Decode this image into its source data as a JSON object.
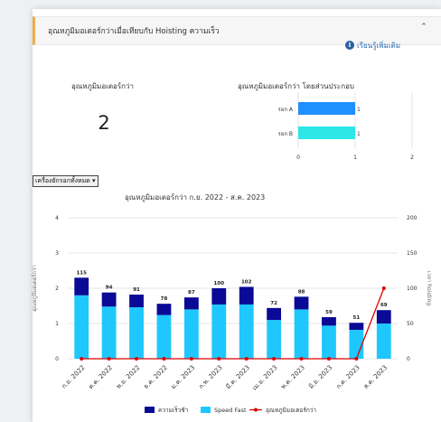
{
  "panel": {
    "title": "อุณหภูมิมอเตอร์กว่าเมื่อเทียบกับ Hoisting ความเร็ว",
    "collapse_icon": "chevron-up-icon",
    "learn_more": "เรียนรู้เพิ่มเติม",
    "accent_color": "#f0ad4e"
  },
  "metric": {
    "label": "อุณหภูมิมอเตอร์กว่า",
    "value": "2"
  },
  "filter": {
    "selected": "เครื่องยักรอกทั้งหมด"
  },
  "chart_data": [
    {
      "type": "bar",
      "orientation": "horizontal",
      "title": "อุณหภูมิมอเตอร์กว่า โดยส่วนประกอบ",
      "categories": [
        "รอก A",
        "รอก B"
      ],
      "values": [
        1,
        1
      ],
      "data_labels": [
        "1",
        "1"
      ],
      "colors": [
        "#1e90ff",
        "#2ee6e6"
      ],
      "xlim": [
        0,
        2
      ],
      "xticks": [
        "0",
        "1",
        "2"
      ]
    },
    {
      "type": "bar",
      "title": "อุณหภูมิมอเตอร์กว่า ก.ย. 2022 - ส.ค. 2023",
      "categories": [
        "ก.ย. 2022",
        "ต.ค. 2022",
        "พ.ย. 2022",
        "ธ.ค. 2022",
        "ม.ค. 2023",
        "ก.พ. 2023",
        "มี.ค. 2023",
        "เม.ย. 2023",
        "พ.ค. 2023",
        "มิ.ย. 2023",
        "ก.ค. 2023",
        "ส.ค. 2023"
      ],
      "series": [
        {
          "name": "ความเร็วช้า",
          "color": "#0a0a96",
          "values": [
            25,
            20,
            18,
            16,
            17,
            23,
            25,
            17,
            18,
            12,
            10,
            19
          ]
        },
        {
          "name": "Speed Fast",
          "color": "#1ec8ff",
          "values": [
            90,
            74,
            73,
            62,
            70,
            77,
            77,
            55,
            70,
            47,
            41,
            50
          ]
        },
        {
          "name": "อุณหภูมิมอเตอร์กว่า",
          "color": "#dd0000",
          "type": "line",
          "values": [
            0,
            0,
            0,
            0,
            0,
            0,
            0,
            0,
            0,
            0,
            0,
            2
          ]
        }
      ],
      "totals": [
        115,
        94,
        91,
        78,
        87,
        100,
        102,
        72,
        88,
        59,
        51,
        69
      ],
      "ylabel_left": "อุณหภูมิมอเตอร์กว่า",
      "ylabel_right": "เวลา hoisting",
      "ylim_left": [
        0,
        4
      ],
      "ylim_right": [
        0,
        200
      ],
      "yticks_left": [
        "0",
        "1",
        "2",
        "3",
        "4"
      ],
      "yticks_right": [
        "0",
        "50",
        "100",
        "150",
        "200"
      ]
    }
  ]
}
